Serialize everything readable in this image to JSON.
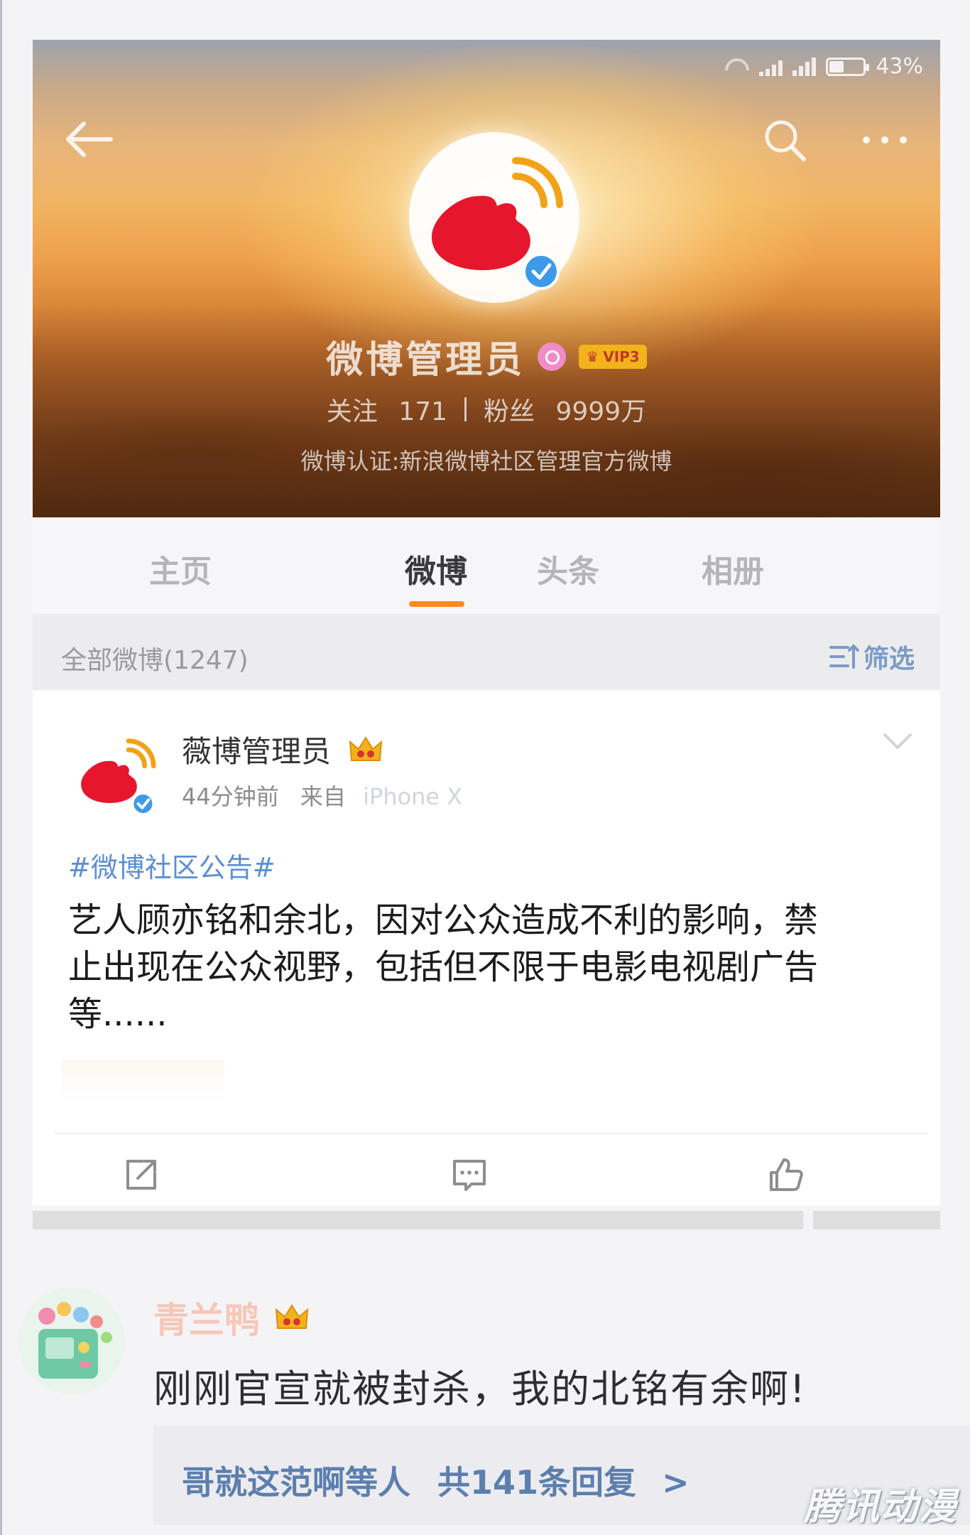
{
  "status_bar": {
    "battery": "43%",
    "battery_level": 0.43
  },
  "profile": {
    "name": "微博管理员",
    "vip": "VIP3",
    "follow_label": "关注",
    "follow_count": "171",
    "fans_label": "粉丝",
    "fans_count": "9999万",
    "verified": "微博认证:新浪微博社区管理官方微博"
  },
  "tabs": [
    {
      "label": "主页",
      "active": false
    },
    {
      "label": "微博",
      "active": true
    },
    {
      "label": "头条",
      "active": false
    },
    {
      "label": "相册",
      "active": false
    }
  ],
  "filter_bar": {
    "all_label": "全部微博(1247)",
    "filter_label": "筛选"
  },
  "post": {
    "author": "薇博管理员",
    "time": "44分钟前",
    "source_prefix": "来自",
    "source": "iPhone X",
    "hashtag": "#微博社区公告#",
    "text": "艺人顾亦铭和余北，因对公众造成不利的影响，禁止出现在公众视野，包括但不限于电影电视剧广告等......"
  },
  "comment": {
    "author": "青兰鸭",
    "text": "刚刚官宣就被封杀，我的北铭有余啊!",
    "reply_users": "哥就这范啊等人",
    "reply_count": "共141条回复",
    "reply_arrow": ">"
  },
  "watermark": "腾讯动漫",
  "icons": [
    "back-arrow-icon",
    "search-icon",
    "more-icon",
    "weibo-logo-icon",
    "verified-icon",
    "crown-icon",
    "chevron-down-icon",
    "filter-icon",
    "share-icon",
    "comment-icon",
    "like-icon"
  ],
  "colors": {
    "accent_orange": "#ff8a1c",
    "link_blue": "#5b8fd1",
    "weibo_red": "#e6162d",
    "verified_blue": "#3d9ae8"
  }
}
